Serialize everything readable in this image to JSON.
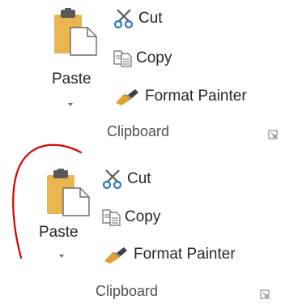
{
  "clipboard_groups": [
    {
      "paste": {
        "label": "Paste",
        "icon": "paste-icon",
        "dropdown_icon": "chevron-down-icon"
      },
      "commands": [
        {
          "id": "cut",
          "label": "Cut",
          "icon": "scissors-icon"
        },
        {
          "id": "copy",
          "label": "Copy",
          "icon": "copy-icon"
        },
        {
          "id": "format-painter",
          "label": "Format Painter",
          "icon": "paintbrush-icon"
        }
      ],
      "group_label": "Clipboard",
      "launcher_icon": "dialog-launcher-icon"
    },
    {
      "paste": {
        "label": "Paste",
        "icon": "paste-icon",
        "dropdown_icon": "chevron-down-icon"
      },
      "commands": [
        {
          "id": "cut",
          "label": "Cut",
          "icon": "scissors-icon"
        },
        {
          "id": "copy",
          "label": "Copy",
          "icon": "copy-icon"
        },
        {
          "id": "format-painter",
          "label": "Format Painter",
          "icon": "paintbrush-icon"
        }
      ],
      "group_label": "Clipboard",
      "launcher_icon": "dialog-launcher-icon"
    }
  ],
  "annotation": {
    "shape": "circle-arc",
    "color": "#d90000"
  },
  "colors": {
    "clipboard_board": "#e8b54e",
    "clipboard_clip": "#595959",
    "scissors_blade": "#5a5a5a",
    "scissors_handle": "#2e78c2",
    "brush_handle": "#3f3f3f",
    "brush_bristles": "#e2a033"
  }
}
